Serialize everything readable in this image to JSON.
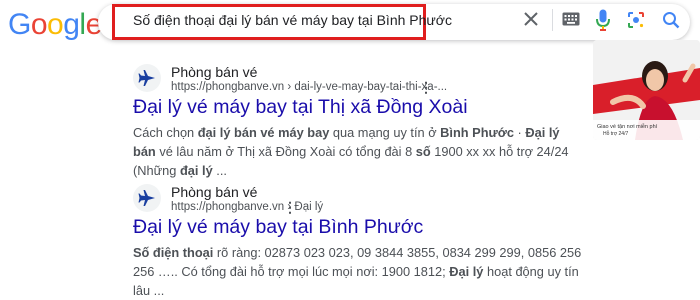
{
  "logo": {
    "text": "Google",
    "letters": [
      "G",
      "o",
      "o",
      "g",
      "l",
      "e"
    ],
    "colors": [
      "#4285F4",
      "#EA4335",
      "#FBBC05",
      "#4285F4",
      "#34A853",
      "#EA4335"
    ]
  },
  "search": {
    "query": "Số điện thoại đại lý bán vé máy bay tại Bình Phước"
  },
  "icons": [
    "close-icon",
    "keyboard-icon",
    "mic-icon",
    "lens-icon",
    "search-icon"
  ],
  "results": [
    {
      "site_name": "Phòng bán vé",
      "url": "https://phongbanve.vn › dai-ly-ve-may-bay-tai-thi-xa-...",
      "title": "Đại lý vé máy bay tại Thị xã Đồng Xoài",
      "snippet": [
        {
          "t": "Cách chọn ",
          "b": false
        },
        {
          "t": "đại lý bán vé máy bay",
          "b": true
        },
        {
          "t": " qua mạng uy tín ở ",
          "b": false
        },
        {
          "t": "Bình Phước",
          "b": true
        },
        {
          "t": " · ",
          "b": false
        },
        {
          "t": "Đại lý bán",
          "b": true
        },
        {
          "t": " vé lâu năm ở Thị xã Đồng Xoài có tổng đài 8 ",
          "b": false
        },
        {
          "t": "số",
          "b": true
        },
        {
          "t": " 1900 xx xx hỗ trợ 24/24 (Những ",
          "b": false
        },
        {
          "t": "đại lý",
          "b": true
        },
        {
          "t": " ...",
          "b": false
        }
      ]
    },
    {
      "site_name": "Phòng bán vé",
      "url": "https://phongbanve.vn › Đại lý",
      "title": "Đại lý vé máy bay tại Bình Phước",
      "snippet": [
        {
          "t": "Số điện thoại",
          "b": true
        },
        {
          "t": " rõ ràng: 02873 023 023, 09 3844 3855, 0834 299 299, 0856 256 256 ….. Có tổng đài hỗ trợ mọi lúc mọi nơi: 1900 1812; ",
          "b": false
        },
        {
          "t": "Đại lý",
          "b": true
        },
        {
          "t": " hoạt động uy tín lâu ...",
          "b": false
        }
      ]
    }
  ],
  "thumbnail": {
    "caption_line1": "Giao vé tận nơi miễn phí",
    "caption_line2": "Hỗ trợ 24/7"
  },
  "colors": {
    "link": "#1a0dab",
    "highlight": "#e01e1e",
    "favicon": "#1a3fa0"
  }
}
